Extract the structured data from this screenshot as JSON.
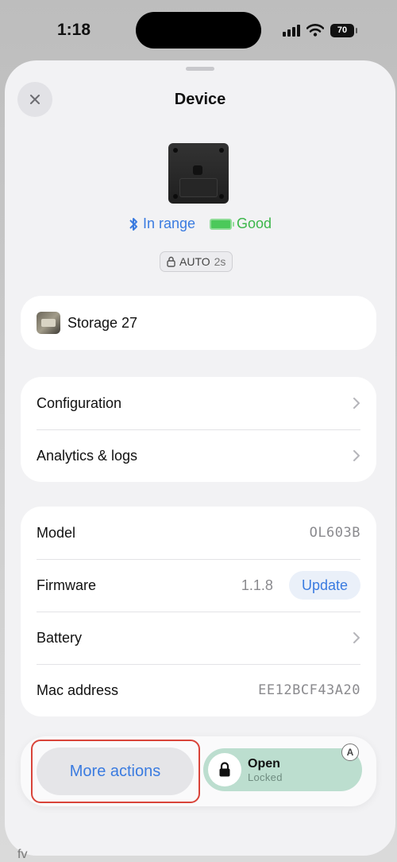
{
  "status_bar": {
    "time": "1:18",
    "battery": "70"
  },
  "header": {
    "title": "Device"
  },
  "device_status": {
    "connection": "In range",
    "battery": "Good",
    "auto_label": "AUTO",
    "auto_interval": "2s"
  },
  "storage": {
    "name": "Storage 27"
  },
  "nav": {
    "configuration": "Configuration",
    "analytics": "Analytics & logs"
  },
  "info": {
    "model_label": "Model",
    "model_value": "OL603B",
    "firmware_label": "Firmware",
    "firmware_value": "1.1.8",
    "update_label": "Update",
    "battery_label": "Battery",
    "mac_label": "Mac address",
    "mac_value": "EE12BCF43A20"
  },
  "actions": {
    "more": "More actions",
    "open_title": "Open",
    "open_sub": "Locked",
    "auto_icon": "A"
  },
  "footer": {
    "partial_text": "fv"
  },
  "colors": {
    "accent": "#3a7be0",
    "good": "#3cb64a",
    "open_bg": "#bcdecf",
    "highlight": "#d9443a"
  }
}
